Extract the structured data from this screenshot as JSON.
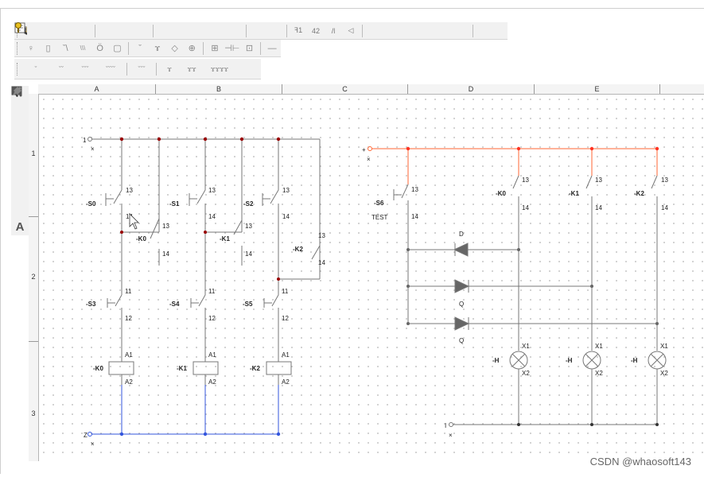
{
  "toolbar": {
    "row1_icons": [
      "new-file-icon",
      "open-folder-icon",
      "save-icon",
      "print-icon",
      "cut-icon",
      "copy-icon",
      "paste-icon",
      "zoom-in-icon",
      "zoom-out-icon",
      "zoom-window-icon",
      "zoom-all-icon",
      "zoom-page-icon",
      "undo-icon",
      "redo-icon",
      "mirror-icon",
      "rotate-icon",
      "flip-icon",
      "turn-icon",
      "run-icon",
      "stop-icon",
      "pause-icon",
      "step-icon",
      "component-icon",
      "library-icon",
      "help-icon"
    ],
    "row2_icons": [
      "lamp-icon",
      "fuse-icon",
      "breaker-icon",
      "triple-breaker-icon",
      "motor-icon",
      "box-icon",
      "switch-icon",
      "contact-icon",
      "diamond-icon",
      "plug-icon",
      "sensor-icon",
      "resistor-icon",
      "transformer-icon",
      "line-icon"
    ],
    "row3_icons": [
      "single-contact-icon",
      "double-contact-icon",
      "triple-contact-icon",
      "quad-contact-icon",
      "timer-icon",
      "nc-contact-icon",
      "nc-double-icon",
      "nc-quad-icon"
    ]
  },
  "palette": {
    "icons": [
      "pointer-icon",
      "line-tool-icon",
      "rectangle-icon",
      "ellipse-icon",
      "filled-rectangle-icon",
      "filled-ellipse-icon",
      "fill-icon",
      "pen-icon",
      "text-tool-icon"
    ]
  },
  "columns": [
    "A",
    "B",
    "C",
    "D",
    "E"
  ],
  "rows": [
    "1",
    "2",
    "3"
  ],
  "circuit_left": {
    "supply_top": "1",
    "supply_bottom": "Z",
    "start_buttons": [
      "-S0",
      "-S1",
      "-S2"
    ],
    "stop_buttons": [
      "-S3",
      "-S4",
      "-S5"
    ],
    "holding_contacts": [
      "-K0",
      "-K1",
      "-K2"
    ],
    "coils": [
      "-K0",
      "-K1",
      "-K2"
    ],
    "contact_no_top": "13",
    "contact_no_bottom": "14",
    "contact_nc_top": "11",
    "contact_nc_bottom": "12",
    "coil_top": "A1",
    "coil_bottom": "A2",
    "terminal_mark": "×"
  },
  "circuit_right": {
    "supply_top": "+",
    "supply_bottom": "I",
    "test_button": "-S6",
    "test_label": "TEST",
    "relay_contacts": [
      "-K0",
      "-K1",
      "-K2"
    ],
    "diode_marks": [
      "D",
      "Q",
      "Q"
    ],
    "lamps": [
      "-H",
      "-H",
      "-H"
    ],
    "lamp_top": "X1",
    "lamp_bottom": "X2",
    "contact_no_top": "13",
    "contact_no_bottom": "14",
    "terminal_mark": "×",
    "colors": {
      "positive": "#ff6633",
      "negative": "#777777"
    }
  },
  "colors": {
    "wire": "#777777",
    "bus_top": "#777777",
    "bus_bottom": "#3355dd",
    "node": "#990000"
  },
  "watermark": "CSDN @whaosoft143"
}
